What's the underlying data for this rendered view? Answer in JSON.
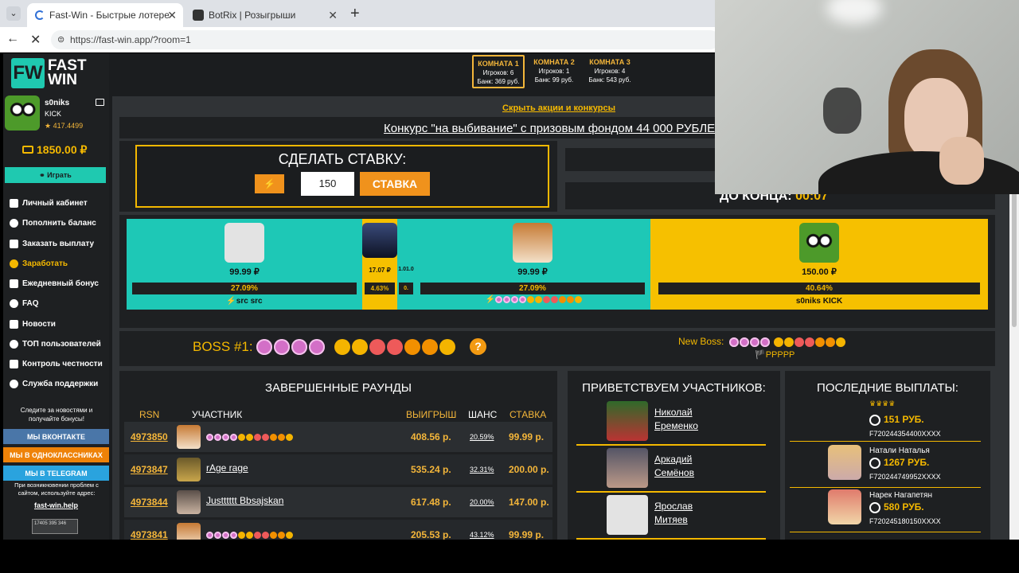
{
  "browser": {
    "tabs": [
      {
        "title": "Fast-Win - Быстрые лотереи! Ком"
      },
      {
        "title": "BotRix | Розыгрыши"
      }
    ],
    "new_tab": "+",
    "url": "https://fast-win.app/?room=1"
  },
  "logo": {
    "mark": "FW",
    "line1": "FAST",
    "line2": "WIN"
  },
  "user": {
    "name": "s0niks",
    "platform": "KICK",
    "rating": "★ 417.4499",
    "balance": "1850.00 ₽",
    "play_button": "⚭ Играть"
  },
  "sidebar": {
    "items": [
      {
        "label": "Личный кабинет",
        "icon": "bank-icon"
      },
      {
        "label": "Пополнить баланс",
        "icon": "plus-circle-icon"
      },
      {
        "label": "Заказать выплату",
        "icon": "arrow-circle-icon"
      },
      {
        "label": "Заработать",
        "icon": "money-icon"
      },
      {
        "label": "Ежедневный бонус",
        "icon": "gift-icon"
      },
      {
        "label": "FAQ",
        "icon": "question-icon"
      },
      {
        "label": "Новости",
        "icon": "bookmark-icon"
      },
      {
        "label": "ТОП пользователей",
        "icon": "trophy-icon"
      },
      {
        "label": "Контроль честности",
        "icon": "shuffle-icon"
      },
      {
        "label": "Служба поддержки",
        "icon": "support-icon"
      }
    ],
    "social_text": "Следите за новостями и получайте бонусы!",
    "vk_button": "МЫ ВКОНТАКТЕ",
    "ok_button": "МЫ В ОДНОКЛАССНИКАХ",
    "tg_button": "МЫ В TELEGRAM",
    "help_text": "При возникновении проблем с сайтом, используйте адрес:",
    "help_link": "fast-win.help",
    "counter": "17405 395 346"
  },
  "rooms": [
    {
      "title": "КОМНАТА 1",
      "players": "Игроков: 6",
      "bank": "Банк: 369 руб."
    },
    {
      "title": "КОМНАТА 2",
      "players": "Игроков: 1",
      "bank": "Банк: 99 руб."
    },
    {
      "title": "КОМНАТА 3",
      "players": "Игроков: 4",
      "bank": "Банк: 543 руб."
    }
  ],
  "promo": {
    "hide_link": "Скрыть акции и конкурсы",
    "contest": "Конкурс \"на выбивание\" с призовым фондом 44 000 РУБЛЕЙ"
  },
  "bet": {
    "title": "СДЕЛАТЬ СТАВКУ:",
    "lightning": "⚡",
    "value": "150",
    "button": "СТАВКА"
  },
  "timer": {
    "label": "ДО КОНЦА:",
    "value": "00:07"
  },
  "arena": {
    "players": [
      {
        "amount": "99.99 ₽",
        "percent": "27.09%",
        "name": "⚡src src",
        "color": "#1ec8b6"
      },
      {
        "amount": "17.07 ₽",
        "percent": "4.63%",
        "name": "",
        "color": "#f6c000"
      },
      {
        "amount": "1.01.0",
        "percent": "0.",
        "name": "",
        "color": "#1ec8b6"
      },
      {
        "amount": "99.99 ₽",
        "percent": "27.09%",
        "name": "",
        "color": "#1ec8b6"
      },
      {
        "amount": "150.00 ₽",
        "percent": "40.64%",
        "name": "s0niks KICK",
        "color": "#f6c000"
      }
    ]
  },
  "boss": {
    "label": "BOSS #1:",
    "question": "?",
    "new_boss_label": "New Boss:",
    "new_boss_flag": "🏴PPPPP"
  },
  "rounds": {
    "title": "ЗАВЕРШЕННЫЕ РАУНДЫ",
    "headers": {
      "rsn": "RSN",
      "participant": "УЧАСТНИК",
      "win": "ВЫИГРЫШ",
      "chance": "ШАНС",
      "bet": "СТАВКА"
    },
    "rows": [
      {
        "id": "4973850",
        "name": "",
        "win": "408.56 р.",
        "chance": "20.59%",
        "bet": "99.99 р."
      },
      {
        "id": "4973847",
        "name": "rAge rage",
        "win": "535.24 р.",
        "chance": "32.31%",
        "bet": "200.00 р."
      },
      {
        "id": "4973844",
        "name": "Justttttt Bbsajskan",
        "win": "617.48 р.",
        "chance": "20.00%",
        "bet": "147.00 р."
      },
      {
        "id": "4973841",
        "name": "",
        "win": "205.53 р.",
        "chance": "43.12%",
        "bet": "99.99 р."
      }
    ]
  },
  "welcome": {
    "title": "ПРИВЕТСТВУЕМ УЧАСТНИКОВ:",
    "people": [
      {
        "first": "Николай",
        "last": "Еременко"
      },
      {
        "first": "Аркадий",
        "last": "Семёнов"
      },
      {
        "first": "Ярослав",
        "last": "Митяев"
      }
    ]
  },
  "payouts": {
    "title": "ПОСЛЕДНИЕ ВЫПЛАТЫ:",
    "items": [
      {
        "name": "",
        "amount": "151 РУБ.",
        "code": "F720244354400XXXX"
      },
      {
        "name": "Натали Наталья",
        "amount": "1267 РУБ.",
        "code": "F720244749952XXXX"
      },
      {
        "name": "Нарек Нагапетян",
        "amount": "580 РУБ.",
        "code": "F720245180150XXXX"
      }
    ]
  }
}
